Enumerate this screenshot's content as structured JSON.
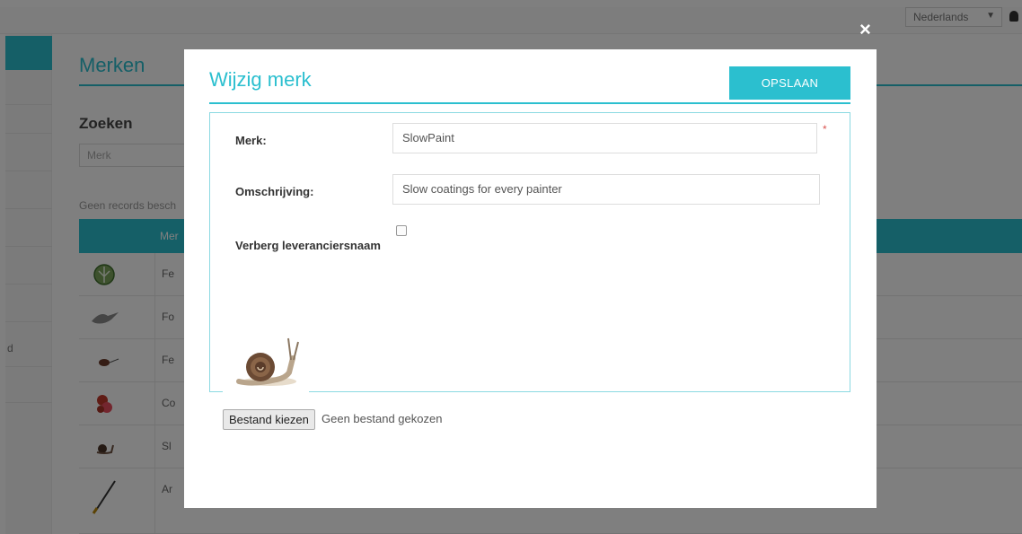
{
  "header": {
    "language": "Nederlands",
    "caret": "▼"
  },
  "page": {
    "title": "Merken",
    "search_title": "Zoeken",
    "search_placeholder": "Merk",
    "no_records_text": "Geen records besch",
    "table_header": "Mer",
    "sidebar_partial_label": "d",
    "rows": [
      {
        "thumb": "leaf-logo-icon",
        "name": "Fe"
      },
      {
        "thumb": "bird-logo-icon",
        "name": "Fo"
      },
      {
        "thumb": "bug-logo-icon",
        "name": "Fe"
      },
      {
        "thumb": "flower-logo-icon",
        "name": "Co"
      },
      {
        "thumb": "snail-logo-icon",
        "name": "Sl"
      },
      {
        "thumb": "brush-logo-icon",
        "name": "Ar"
      }
    ]
  },
  "modal": {
    "close_symbol": "×",
    "title": "Wijzig merk",
    "save_label": "OPSLAAN",
    "fields": {
      "merk": {
        "label": "Merk:",
        "value": "SlowPaint",
        "required_mark": "*"
      },
      "omschrijving": {
        "label": "Omschrijving:",
        "value": "Slow coatings for every painter"
      },
      "verberg": {
        "label": "Verberg leveranciersnaam",
        "checked": false
      }
    },
    "file": {
      "button_label": "Bestand kiezen",
      "status": "Geen bestand gekozen",
      "preview_icon": "snail-icon"
    }
  },
  "colors": {
    "accent": "#2bbfcf",
    "required": "#d9534f"
  }
}
